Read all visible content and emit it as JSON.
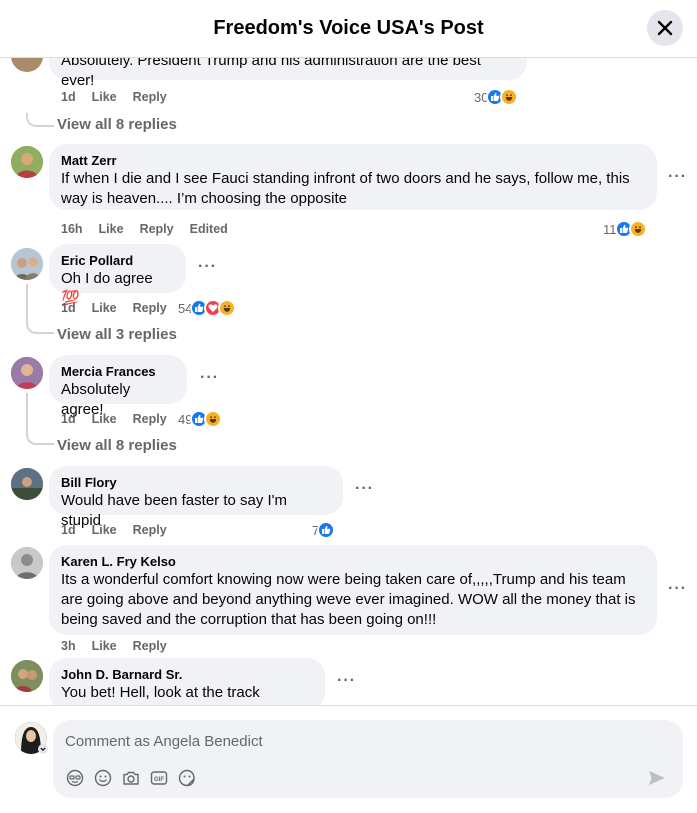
{
  "header": {
    "title": "Freedom's Voice USA's Post"
  },
  "actions": {
    "like": "Like",
    "reply": "Reply",
    "edited": "Edited"
  },
  "comments": [
    {
      "author": "",
      "text": "Absolutely. President Trump and his administration are the best ever!",
      "time": "1d",
      "reactions": "30",
      "reaction_types": [
        "like",
        "haha"
      ]
    },
    {
      "author": "Matt Zerr",
      "text_line1": "If when I die and I see Fauci standing infront of two doors and he says, follow me, this",
      "text_line2": "way is heaven.... I’m choosing the opposite",
      "time": "16h",
      "reactions": "11",
      "reaction_types": [
        "like",
        "haha"
      ]
    },
    {
      "author": "Eric Pollard",
      "text": "Oh I do agree 💯",
      "time": "1d",
      "reactions": "54",
      "reaction_types": [
        "like",
        "love",
        "haha"
      ]
    },
    {
      "author": "Mercia Frances",
      "text": "Absolutely agree!",
      "time": "1d",
      "reactions": "49",
      "reaction_types": [
        "like",
        "haha"
      ]
    },
    {
      "author": "Bill Flory",
      "text": "Would have been faster to say I'm stupid",
      "time": "1d",
      "reactions": "7",
      "reaction_types": [
        "like"
      ]
    },
    {
      "author": "Karen L. Fry Kelso",
      "text_line1": "Its a wonderful comfort knowing now were being taken care of,,,,,Trump and his team",
      "text_line2": "are going above and beyond anything weve ever imagined. WOW all the money that is",
      "text_line3": "being saved and the corruption that has been going on!!!",
      "time": "3h"
    },
    {
      "author": "John D. Barnard Sr.",
      "text": "You bet! Hell, look at the track records"
    }
  ],
  "view_replies": {
    "first": "View all 8 replies",
    "eric": "View all 3 replies",
    "mercia": "View all 8 replies"
  },
  "composer": {
    "placeholder": "Comment as Angela Benedict"
  },
  "icons": [
    "close-icon",
    "avatar-icon",
    "like-reaction-icon",
    "haha-reaction-icon",
    "love-reaction-icon",
    "avatar-sticker-icon",
    "emoji-icon",
    "camera-icon",
    "gif-icon",
    "sticker-icon",
    "send-icon"
  ],
  "colors": {
    "like": "#1877f2",
    "haha": "#f7b125",
    "love": "#f33e58",
    "bubble": "#f0f2f5",
    "meta": "#65676b"
  }
}
